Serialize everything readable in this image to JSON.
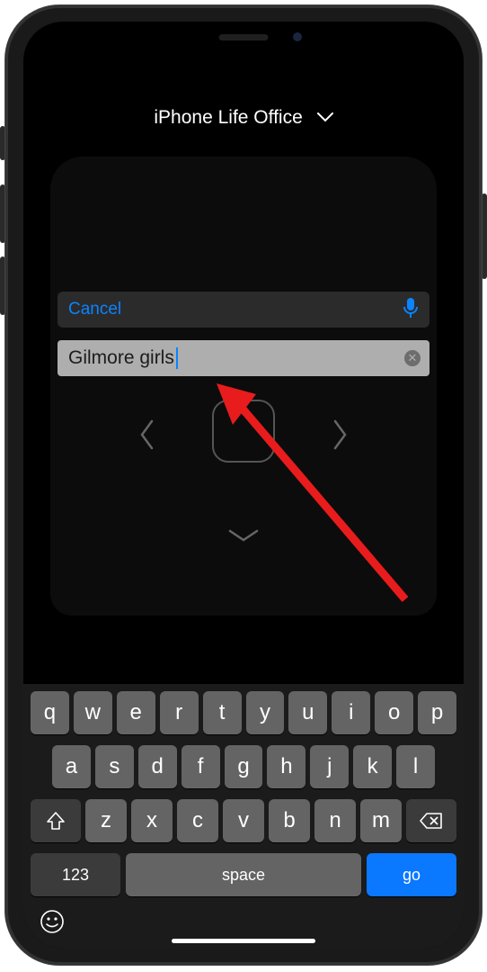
{
  "header": {
    "title": "iPhone Life Office"
  },
  "search": {
    "cancel": "Cancel",
    "input_value": "Gilmore girls"
  },
  "keyboard": {
    "row1": [
      "q",
      "w",
      "e",
      "r",
      "t",
      "y",
      "u",
      "i",
      "o",
      "p"
    ],
    "row2": [
      "a",
      "s",
      "d",
      "f",
      "g",
      "h",
      "j",
      "k",
      "l"
    ],
    "row3": [
      "z",
      "x",
      "c",
      "v",
      "b",
      "n",
      "m"
    ],
    "numbers": "123",
    "space": "space",
    "go": "go"
  }
}
